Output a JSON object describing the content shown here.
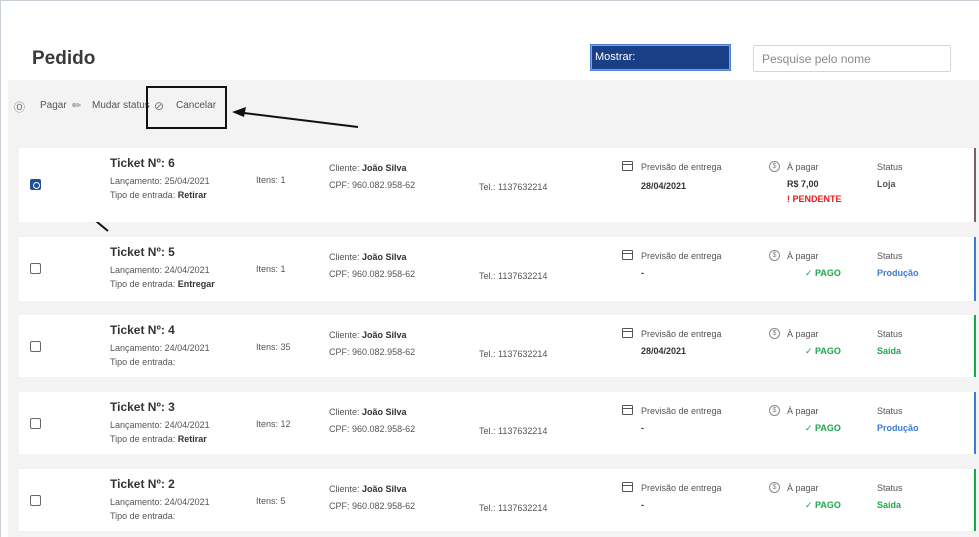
{
  "page_title": "Pedido",
  "mostrar": {
    "label": "Mostrar:"
  },
  "search": {
    "placeholder": "Pesquise pelo nome"
  },
  "toolbar": {
    "pagar": "Pagar",
    "mudar_status": "Mudar status",
    "cancelar": "Cancelar"
  },
  "labels": {
    "lancamento": "Lançamento:",
    "tipo_entrada": "Tipo de entrada:",
    "itens": "Itens:",
    "cliente": "Cliente:",
    "cpf": "CPF:",
    "tel": "Tel.:",
    "previsao": "Previsão de entrega",
    "a_pagar": "À pagar",
    "status": "Status"
  },
  "colors": {
    "accent_blue": "#1b3f86",
    "pago_green": "#1aa84c",
    "pendente_red": "#e02020",
    "status_blue": "#3a7bd5"
  },
  "tickets": [
    {
      "title": "Ticket Nº: 6",
      "lancamento": "25/04/2021",
      "tipo": "Retirar",
      "itens": "1",
      "cliente": "João Silva",
      "cpf": "960.082.958-62",
      "tel": "1137632214",
      "previsao": "28/04/2021",
      "pay_value": "R$ 7,00",
      "pay_status": "! PENDENTE",
      "status": "Loja",
      "checked": true
    },
    {
      "title": "Ticket Nº: 5",
      "lancamento": "24/04/2021",
      "tipo": "Entregar",
      "itens": "1",
      "cliente": "João Silva",
      "cpf": "960.082.958-62",
      "tel": "1137632214",
      "previsao": "-",
      "pay_status": "✓ PAGO",
      "status": "Produção",
      "checked": false
    },
    {
      "title": "Ticket Nº: 4",
      "lancamento": "24/04/2021",
      "tipo": "",
      "itens": "35",
      "cliente": "João Silva",
      "cpf": "960.082.958-62",
      "tel": "1137632214",
      "previsao": "28/04/2021",
      "pay_status": "✓ PAGO",
      "status": "Saída",
      "checked": false
    },
    {
      "title": "Ticket Nº: 3",
      "lancamento": "24/04/2021",
      "tipo": "Retirar",
      "itens": "12",
      "cliente": "João Silva",
      "cpf": "960.082.958-62",
      "tel": "1137632214",
      "previsao": "-",
      "pay_status": "✓ PAGO",
      "status": "Produção",
      "checked": false
    },
    {
      "title": "Ticket Nº: 2",
      "lancamento": "24/04/2021",
      "tipo": "",
      "itens": "5",
      "cliente": "João Silva",
      "cpf": "960.082.958-62",
      "tel": "1137632214",
      "previsao": "-",
      "pay_status": "✓ PAGO",
      "status": "Saída",
      "checked": false
    }
  ]
}
